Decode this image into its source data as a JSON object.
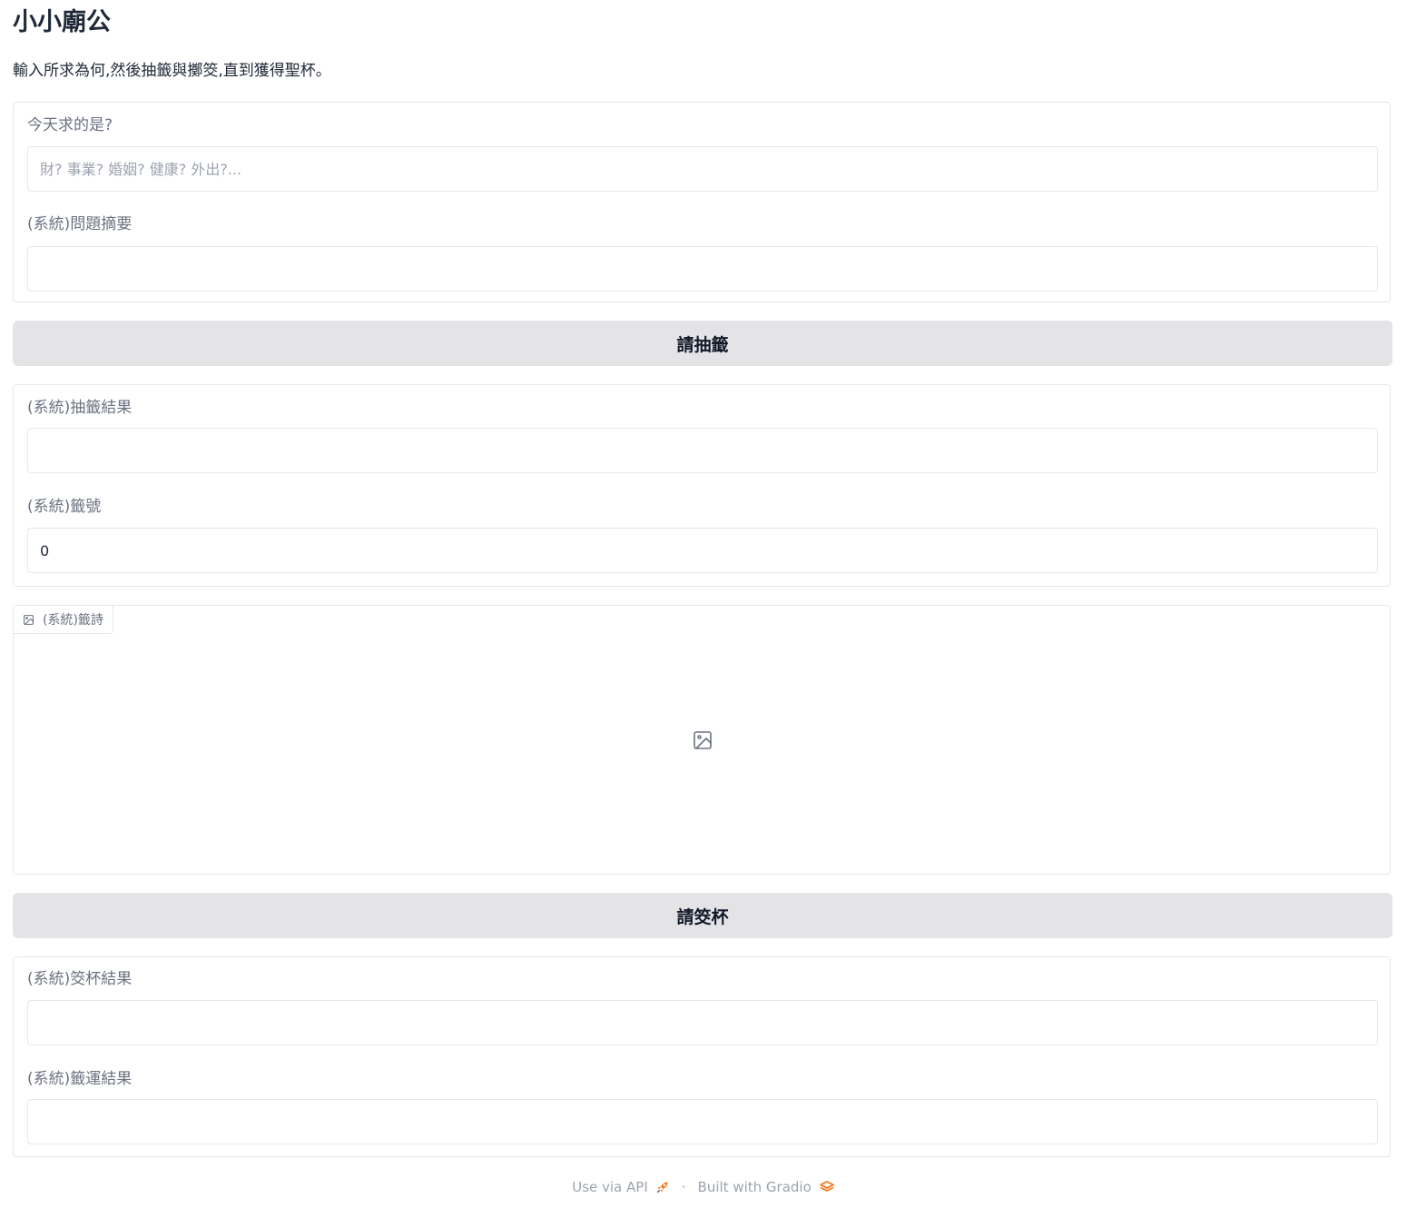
{
  "app": {
    "title": "小小廟公",
    "description": "輸入所求為何,然後抽籤與擲筊,直到獲得聖杯。"
  },
  "question_panel": {
    "question_label": "今天求的是?",
    "question_placeholder": "財? 事業? 婚姻? 健康? 外出?...",
    "question_value": "",
    "summary_label": "(系統)問題摘要",
    "summary_value": ""
  },
  "draw_button": {
    "label": "請抽籤"
  },
  "draw_panel": {
    "draw_result_label": "(系統)抽籤結果",
    "draw_result_value": "",
    "lot_number_label": "(系統)籤號",
    "lot_number_value": "0"
  },
  "poem_image": {
    "label": "(系統)籤詩",
    "icon": "image-icon"
  },
  "cast_button": {
    "label": "請筊杯"
  },
  "cast_panel": {
    "cast_result_label": "(系統)筊杯結果",
    "cast_result_value": "",
    "fortune_result_label": "(系統)籤運結果",
    "fortune_result_value": ""
  },
  "footer": {
    "api_link": "Use via API",
    "separator": "·",
    "built_with": "Built with Gradio",
    "accent_color": "#f97316"
  }
}
